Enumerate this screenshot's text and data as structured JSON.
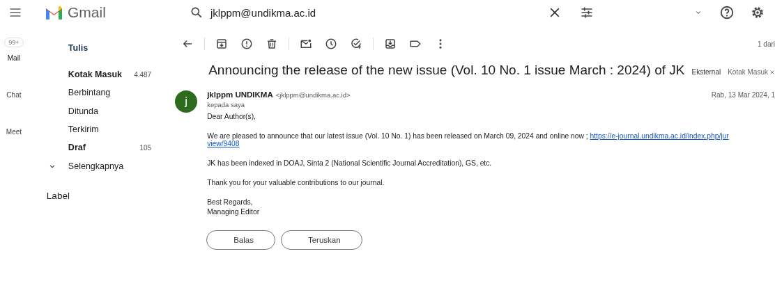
{
  "app": {
    "name": "Gmail"
  },
  "search": {
    "value": "jklppm@undikma.ac.id"
  },
  "rail": {
    "badge": "99+",
    "items": [
      {
        "label": "Mail",
        "selected": true
      },
      {
        "label": "Chat",
        "selected": false
      },
      {
        "label": "Meet",
        "selected": false
      }
    ]
  },
  "compose": {
    "label": "Tulis"
  },
  "folders": [
    {
      "label": "Kotak Masuk",
      "count": "4.487",
      "unread": true,
      "kind": "folder"
    },
    {
      "label": "Berbintang",
      "unread": false,
      "kind": "folder"
    },
    {
      "label": "Ditunda",
      "unread": false,
      "kind": "folder"
    },
    {
      "label": "Terkirim",
      "unread": false,
      "kind": "folder"
    },
    {
      "label": "Draf",
      "count": "105",
      "unread": true,
      "kind": "folder"
    },
    {
      "label": "Selengkapnya",
      "unread": false,
      "kind": "more"
    }
  ],
  "labels_heading": "Label",
  "pager": "1 dari",
  "message": {
    "subject": "Announcing the release of the new issue (Vol. 10 No. 1 issue March : 2024) of JK",
    "tags": [
      "Eksternal",
      "Kotak Masuk"
    ],
    "avatar": "j",
    "sender": "jklppm UNDIKMA",
    "address": "<jklppm@undikma.ac.id>",
    "to": "kepada saya",
    "date": "Rab, 13 Mar 2024, 1",
    "body": [
      {
        "kind": "text",
        "text": "Dear Author(s),"
      },
      {
        "kind": "link_text",
        "text": "We are pleased to announce that our latest issue  (Vol. 10 No. 1) has been released on March 09, 2024 and online now ; ",
        "links": [
          "https://e-journal.undikma.ac.id/index.php/jur",
          "view/9408"
        ]
      },
      {
        "kind": "text",
        "text": "JK has been indexed in DOAJ, Sinta 2 (National Scientific Journal Accreditation), GS, etc."
      },
      {
        "kind": "text",
        "text": "Thank you for your valuable contributions to our journal."
      },
      {
        "kind": "lines",
        "lines": [
          "Best Regards,",
          "Managing Editor"
        ]
      }
    ],
    "actions": [
      "Balas",
      "Teruskan"
    ]
  }
}
